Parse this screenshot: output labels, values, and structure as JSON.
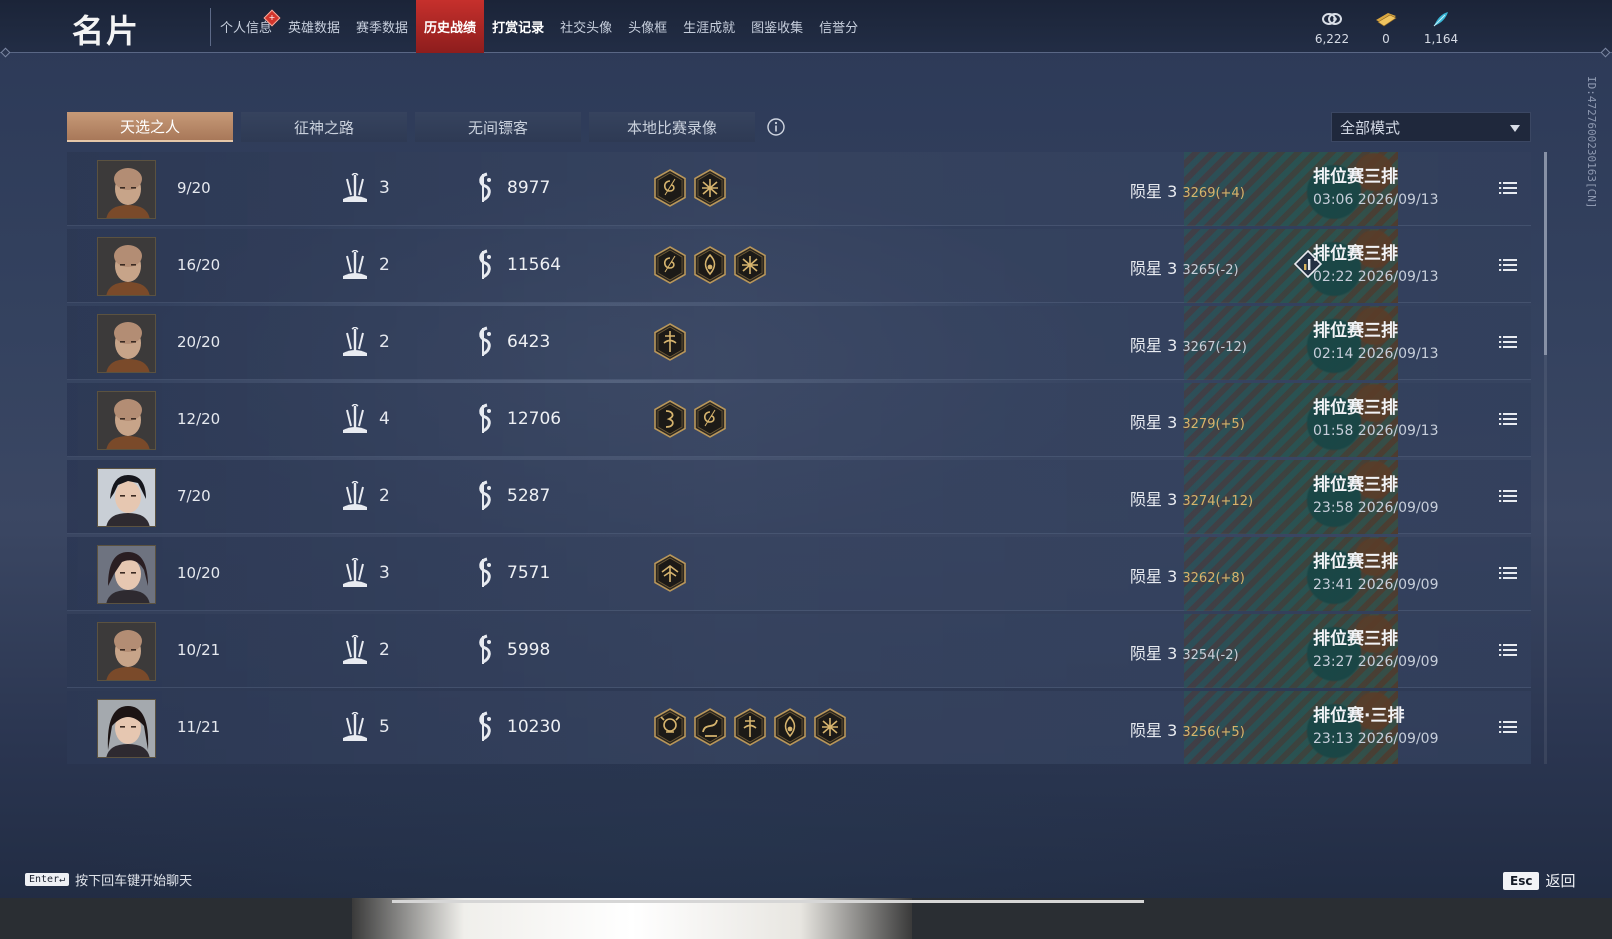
{
  "header": {
    "title": "名片",
    "nav": [
      {
        "label": "个人信息",
        "state": "normal",
        "has_dot": true
      },
      {
        "label": "英雄数据",
        "state": "normal"
      },
      {
        "label": "赛季数据",
        "state": "normal"
      },
      {
        "label": "历史战绩",
        "state": "active"
      },
      {
        "label": "打赏记录",
        "state": "bold"
      },
      {
        "label": "社交头像",
        "state": "normal"
      },
      {
        "label": "头像框",
        "state": "normal"
      },
      {
        "label": "生涯成就",
        "state": "normal"
      },
      {
        "label": "图鉴收集",
        "state": "normal"
      },
      {
        "label": "信誉分",
        "state": "normal"
      }
    ],
    "currencies": [
      {
        "icon": "coin-pile-icon",
        "value": "6,222"
      },
      {
        "icon": "ticket-icon",
        "value": "0"
      },
      {
        "icon": "feather-icon",
        "value": "1,164"
      }
    ]
  },
  "side_id": "ID:4727600230163[CN]",
  "tabs": [
    "天选之人",
    "征神之路",
    "无间镖客",
    "本地比赛录像"
  ],
  "active_tab": 0,
  "mode_select": {
    "value": "全部模式"
  },
  "matches": [
    {
      "avatar": "monk",
      "kda": "9/20",
      "kills": "3",
      "damage": "8977",
      "badges": [
        "swirl",
        "star"
      ],
      "rank": "陨星 3",
      "score": "3269(+4)",
      "score_up": true,
      "mode": "排位赛三排",
      "time": "03:06  2026/09/13",
      "has_detail": false
    },
    {
      "avatar": "monk",
      "kda": "16/20",
      "kills": "2",
      "damage": "11564",
      "badges": [
        "swirl",
        "flame",
        "star"
      ],
      "rank": "陨星 3",
      "score": "3265(-2)",
      "score_up": false,
      "mode": "排位赛三排",
      "time": "02:22  2026/09/13",
      "has_detail": true
    },
    {
      "avatar": "monk",
      "kda": "20/20",
      "kills": "2",
      "damage": "6423",
      "badges": [
        "sword"
      ],
      "rank": "陨星 3",
      "score": "3267(-12)",
      "score_up": false,
      "mode": "排位赛三排",
      "time": "02:14  2026/09/13",
      "has_detail": false
    },
    {
      "avatar": "monk",
      "kda": "12/20",
      "kills": "4",
      "damage": "12706",
      "badges": [
        "claw",
        "swirl"
      ],
      "rank": "陨星 3",
      "score": "3279(+5)",
      "score_up": true,
      "mode": "排位赛三排",
      "time": "01:58  2026/09/13",
      "has_detail": false
    },
    {
      "avatar": "swordsman",
      "kda": "7/20",
      "kills": "2",
      "damage": "5287",
      "badges": [],
      "rank": "陨星 3",
      "score": "3274(+12)",
      "score_up": true,
      "mode": "排位赛三排",
      "time": "23:58  2026/09/09",
      "has_detail": false
    },
    {
      "avatar": "lady",
      "kda": "10/20",
      "kills": "3",
      "damage": "7571",
      "badges": [
        "bird"
      ],
      "rank": "陨星 3",
      "score": "3262(+8)",
      "score_up": true,
      "mode": "排位赛三排",
      "time": "23:41  2026/09/09",
      "has_detail": false
    },
    {
      "avatar": "monk",
      "kda": "10/21",
      "kills": "2",
      "damage": "5998",
      "badges": [],
      "rank": "陨星 3",
      "score": "3254(-2)",
      "score_up": false,
      "mode": "排位赛三排",
      "time": "23:27  2026/09/09",
      "has_detail": false
    },
    {
      "avatar": "girl",
      "kda": "11/21",
      "kills": "5",
      "damage": "10230",
      "badges": [
        "skull",
        "dragon",
        "sword",
        "flame",
        "star"
      ],
      "rank": "陨星 3",
      "score": "3256(+5)",
      "score_up": true,
      "mode": "排位赛·三排",
      "time": "23:13  2026/09/09",
      "has_detail": false
    }
  ],
  "footer": {
    "chat_key": "Enter↵",
    "chat_hint": "按下回车键开始聊天",
    "esc_key": "Esc",
    "esc_label": "返回"
  }
}
